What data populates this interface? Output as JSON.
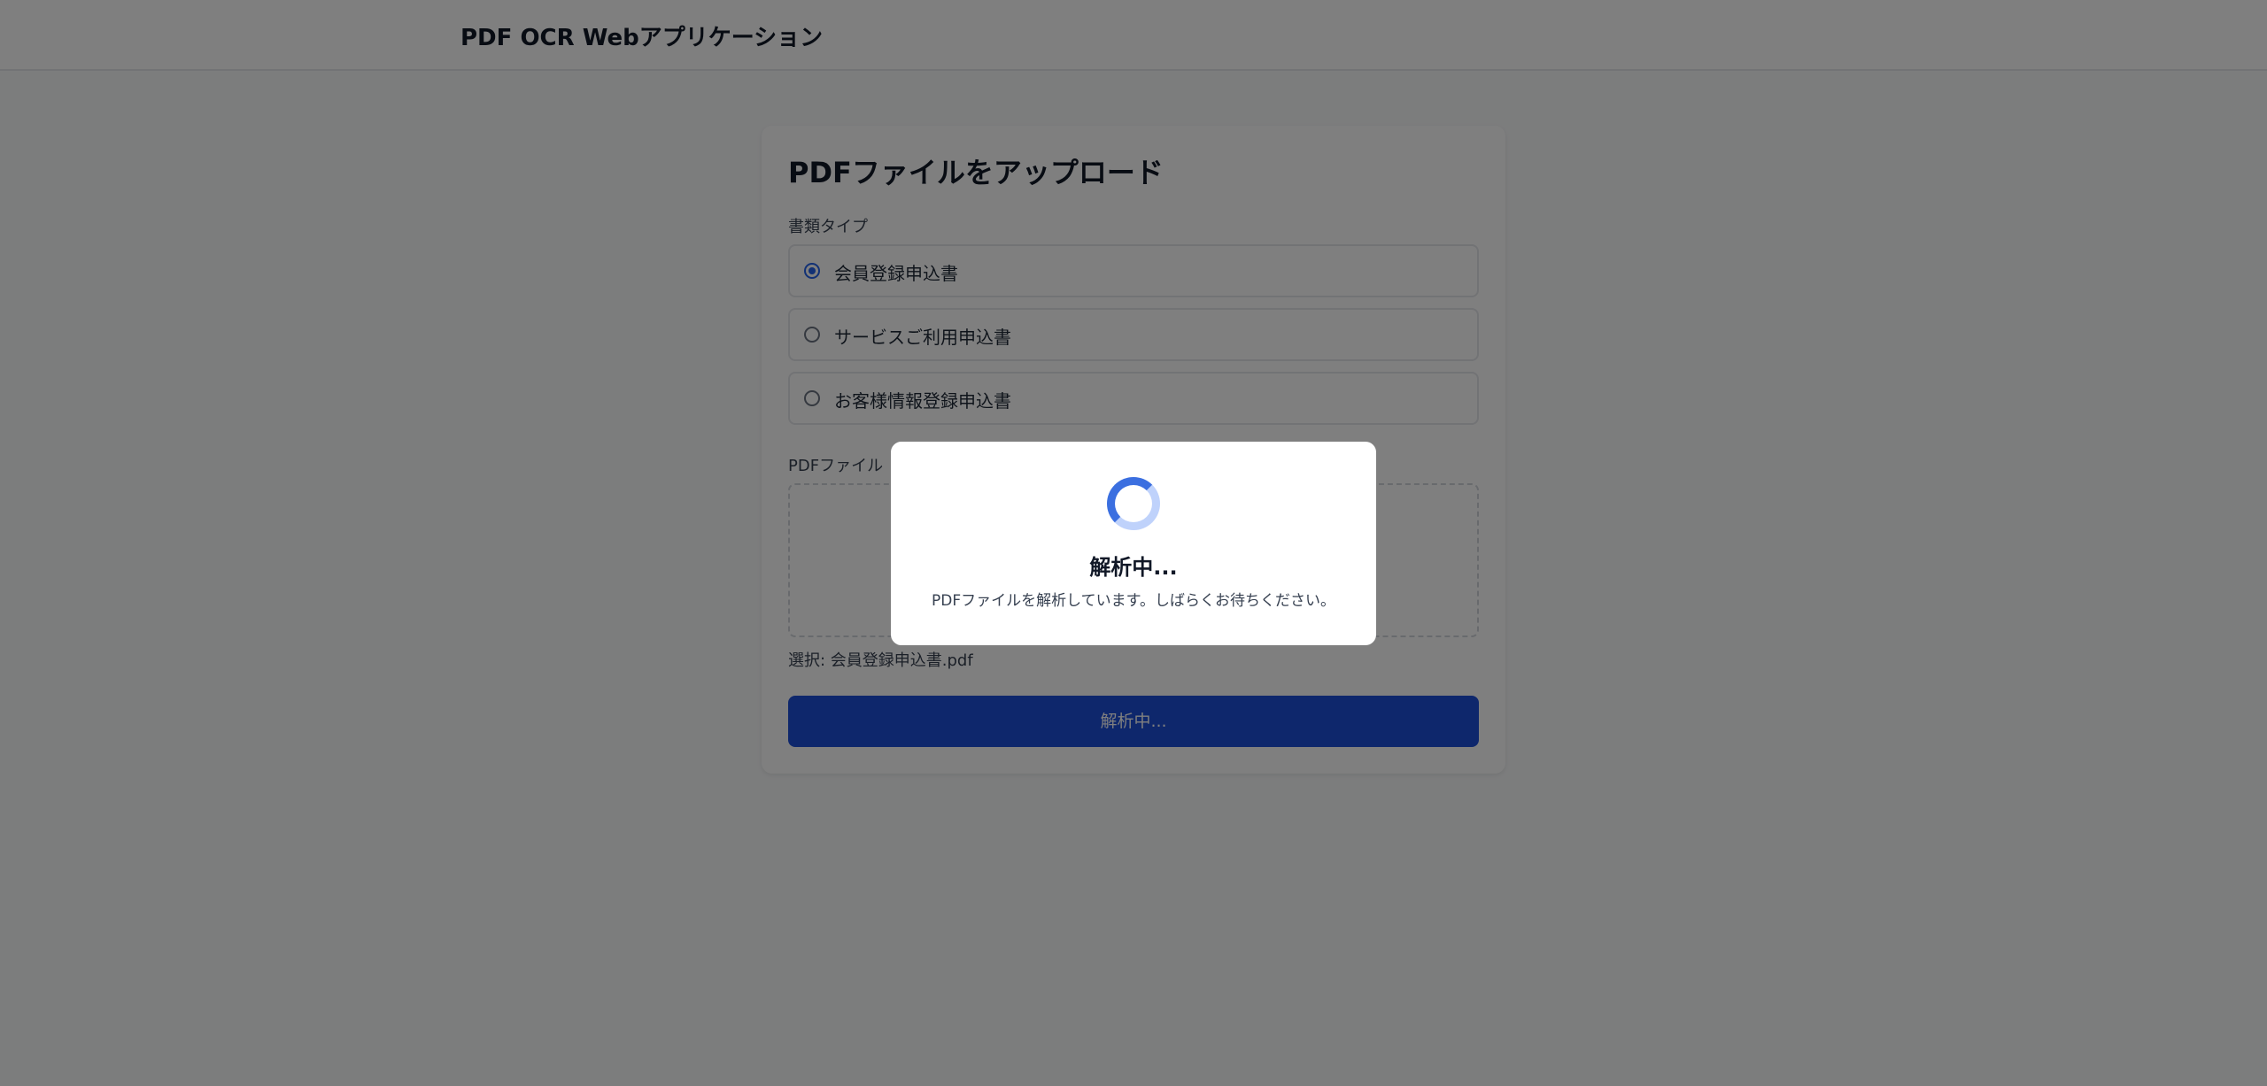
{
  "header": {
    "title": "PDF OCR Webアプリケーション"
  },
  "upload_card": {
    "title": "PDFファイルをアップロード",
    "document_type_label": "書類タイプ",
    "document_types": [
      {
        "label": "会員登録申込書",
        "selected": true
      },
      {
        "label": "サービスご利用申込書",
        "selected": false
      },
      {
        "label": "お客様情報登録申込書",
        "selected": false
      }
    ],
    "file_label": "PDFファイル",
    "selected_file_text": "選択: 会員登録申込書.pdf",
    "submit_label": "解析中..."
  },
  "loading_modal": {
    "title": "解析中...",
    "message": "PDFファイルを解析しています。しばらくお待ちください。"
  },
  "colors": {
    "primary": "#1d4ed8",
    "spinner_active": "#3b6fe0",
    "spinner_track": "#bfd2fb"
  },
  "icons": {
    "spinner": "loading-spinner-icon"
  }
}
